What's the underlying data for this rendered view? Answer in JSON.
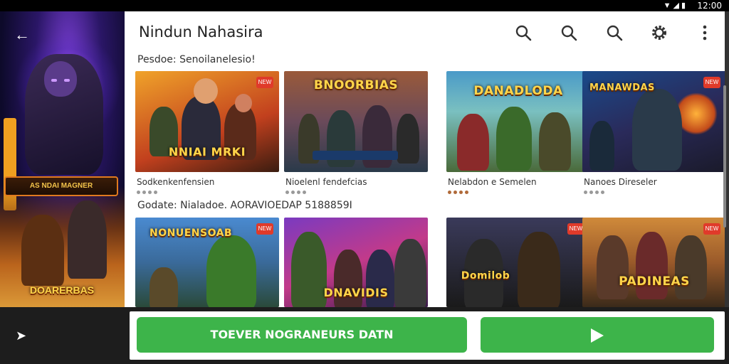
{
  "status": {
    "time": "12:00",
    "icons": "▼◢▮"
  },
  "hero": {
    "banner": "AS NDAI MAGNER",
    "title": "DOARERBAS"
  },
  "appbar": {
    "title": "Nindun Nahasira",
    "icons": [
      "search-icon",
      "search-icon",
      "search-icon",
      "gear-icon",
      "overflow-menu-icon"
    ]
  },
  "sections": [
    {
      "label": "Pesdoe: Senoilanelesio!"
    },
    {
      "label": "Godate: Nialadoe. AORAVIOEDAP 5188859I"
    }
  ],
  "row1": [
    {
      "logo": "NNIAI MRKI",
      "title": "Sodkenkenfensien",
      "badge": "NEW",
      "rating_color": "#888"
    },
    {
      "logo": "BNOORBIAS",
      "title": "Nioelenl fendefcias",
      "badge": "",
      "rating_color": "#888"
    },
    {
      "logo": "DANADLODA",
      "title": "Nelabdon e Semelen",
      "badge": "",
      "rating_color": "#a0522d"
    },
    {
      "logo": "MANAWDAS",
      "title": "Nanoes Direseler",
      "badge": "NEW",
      "rating_color": "#888"
    }
  ],
  "row2": [
    {
      "logo": "NONUENSOAB",
      "badge": "NEW"
    },
    {
      "logo": "DNAVIDIS",
      "badge": ""
    },
    {
      "logo": "Domilob",
      "badge": "NEW"
    },
    {
      "logo": "PADINEAS",
      "badge": "NEW"
    }
  ],
  "bottom": {
    "primary_label": "TOEVER NOGRANEURS DATN",
    "play_label": ""
  }
}
